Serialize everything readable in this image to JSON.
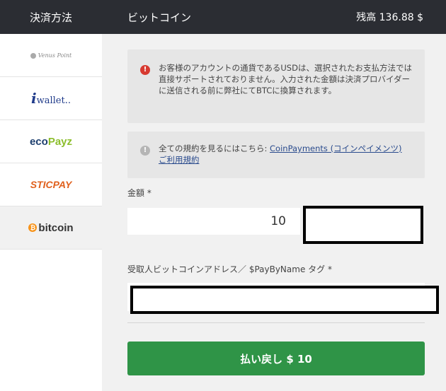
{
  "header": {
    "section_title": "決済方法",
    "page_title": "ビットコイン",
    "balance": "残高 136.88 $"
  },
  "sidebar": {
    "methods": [
      {
        "name": "Venus Point",
        "active": false
      },
      {
        "name": "iwallet",
        "active": false
      },
      {
        "name": "ecoPayz",
        "active": false
      },
      {
        "name": "STICPAY",
        "active": false
      },
      {
        "name": "bitcoin",
        "active": true
      }
    ]
  },
  "notices": {
    "currency_text": "お客様のアカウントの通貨であるUSDは、選択されたお支払方法では直接サポートされておりません。入力された金額は決済プロバイダーに送信される前に弊社にてBTCに換算されます。",
    "terms_prefix": "全ての規約を見るにはこちら: ",
    "terms_link": "CoinPayments (コインペイメンツ) ご利用規約"
  },
  "form": {
    "amount_label": "金額 *",
    "amount_value": "10",
    "address_label": "受取人ビットコインアドレス／ $PayByName タグ *",
    "address_value": "",
    "submit_label": "払い戻し $ 10"
  },
  "colors": {
    "header_bg": "#2b2d33",
    "submit_bg": "#2f9447",
    "error_icon": "#d73a31"
  }
}
